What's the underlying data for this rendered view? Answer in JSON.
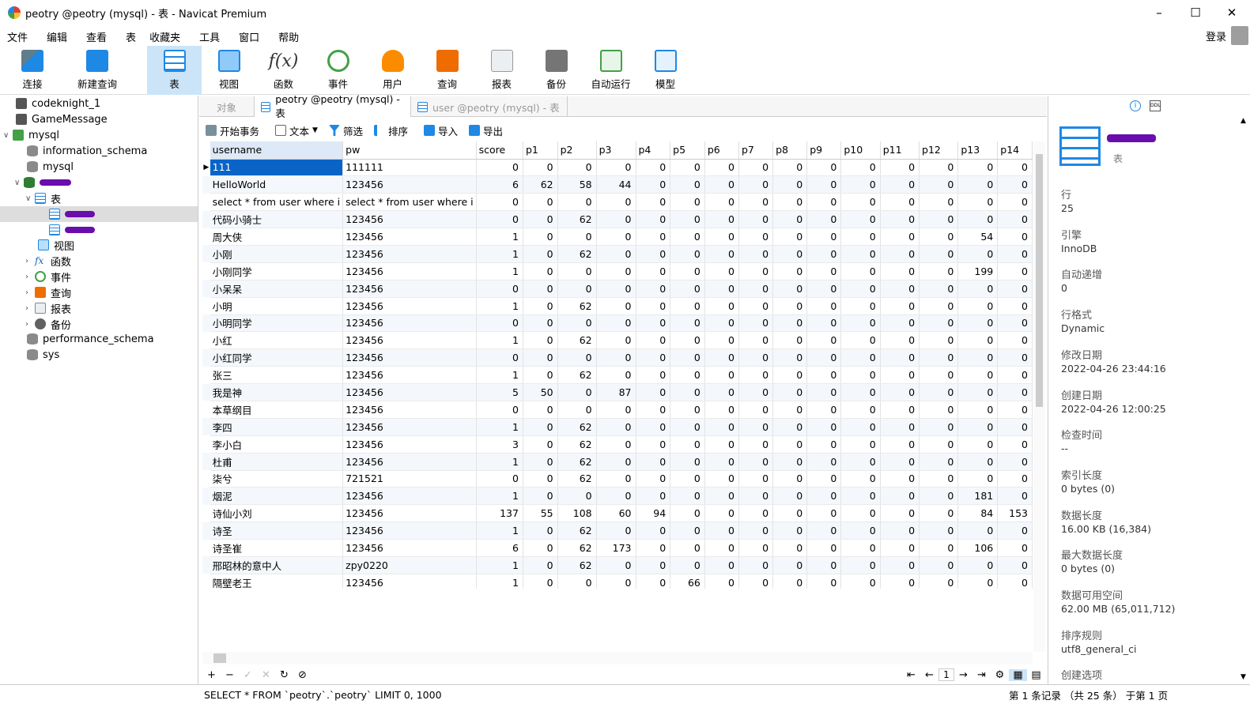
{
  "window": {
    "title": "peotry @peotry (mysql) - 表 - Navicat Premium"
  },
  "menu": [
    "文件",
    "编辑",
    "查看",
    "表",
    "收藏夹",
    "工具",
    "窗口",
    "帮助"
  ],
  "login_label": "登录",
  "toolbar": [
    {
      "label": "连接",
      "icon": "connection-icon"
    },
    {
      "label": "新建查询",
      "icon": "new-query-icon"
    },
    {
      "label": "表",
      "icon": "table-icon",
      "active": true
    },
    {
      "label": "视图",
      "icon": "view-icon"
    },
    {
      "label": "函数",
      "icon": "function-icon"
    },
    {
      "label": "事件",
      "icon": "event-clock-icon"
    },
    {
      "label": "用户",
      "icon": "user-icon"
    },
    {
      "label": "查询",
      "icon": "query-icon"
    },
    {
      "label": "报表",
      "icon": "report-icon"
    },
    {
      "label": "备份",
      "icon": "backup-icon"
    },
    {
      "label": "自动运行",
      "icon": "auto-run-icon"
    },
    {
      "label": "模型",
      "icon": "model-icon"
    }
  ],
  "tree": {
    "codeknight": "codeknight_1",
    "gamemessage": "GameMessage",
    "mysql_conn": "mysql",
    "information_schema": "information_schema",
    "mysql_db": "mysql",
    "tables_group": "表",
    "views": "视图",
    "functions": "函数",
    "events": "事件",
    "queries": "查询",
    "reports": "报表",
    "backups": "备份",
    "performance_schema": "performance_schema",
    "sys": "sys"
  },
  "tabs": {
    "objects": "对象",
    "active": "peotry @peotry (mysql) - 表",
    "other": "user @peotry (mysql) - 表"
  },
  "subtoolbar": {
    "begin": "开始事务",
    "text": "文本",
    "filter": "筛选",
    "sort": "排序",
    "import": "导入",
    "export": "导出"
  },
  "grid": {
    "columns": [
      "username",
      "pw",
      "score",
      "p1",
      "p2",
      "p3",
      "p4",
      "p5",
      "p6",
      "p7",
      "p8",
      "p9",
      "p10",
      "p11",
      "p12",
      "p13",
      "p14"
    ],
    "rows": [
      [
        "111",
        "111111",
        "0",
        "0",
        "0",
        "0",
        "0",
        "0",
        "0",
        "0",
        "0",
        "0",
        "0",
        "0",
        "0",
        "0",
        "0"
      ],
      [
        "HelloWorld",
        "123456",
        "6",
        "62",
        "58",
        "44",
        "0",
        "0",
        "0",
        "0",
        "0",
        "0",
        "0",
        "0",
        "0",
        "0",
        "0"
      ],
      [
        "select * from user where i",
        "select * from user where i",
        "0",
        "0",
        "0",
        "0",
        "0",
        "0",
        "0",
        "0",
        "0",
        "0",
        "0",
        "0",
        "0",
        "0",
        "0"
      ],
      [
        "代码小骑士",
        "123456",
        "0",
        "0",
        "62",
        "0",
        "0",
        "0",
        "0",
        "0",
        "0",
        "0",
        "0",
        "0",
        "0",
        "0",
        "0"
      ],
      [
        "周大侠",
        "123456",
        "1",
        "0",
        "0",
        "0",
        "0",
        "0",
        "0",
        "0",
        "0",
        "0",
        "0",
        "0",
        "0",
        "54",
        "0"
      ],
      [
        "小刚",
        "123456",
        "1",
        "0",
        "62",
        "0",
        "0",
        "0",
        "0",
        "0",
        "0",
        "0",
        "0",
        "0",
        "0",
        "0",
        "0"
      ],
      [
        "小刚同学",
        "123456",
        "1",
        "0",
        "0",
        "0",
        "0",
        "0",
        "0",
        "0",
        "0",
        "0",
        "0",
        "0",
        "0",
        "199",
        "0"
      ],
      [
        "小呆呆",
        "123456",
        "0",
        "0",
        "0",
        "0",
        "0",
        "0",
        "0",
        "0",
        "0",
        "0",
        "0",
        "0",
        "0",
        "0",
        "0"
      ],
      [
        "小明",
        "123456",
        "1",
        "0",
        "62",
        "0",
        "0",
        "0",
        "0",
        "0",
        "0",
        "0",
        "0",
        "0",
        "0",
        "0",
        "0"
      ],
      [
        "小明同学",
        "123456",
        "0",
        "0",
        "0",
        "0",
        "0",
        "0",
        "0",
        "0",
        "0",
        "0",
        "0",
        "0",
        "0",
        "0",
        "0"
      ],
      [
        "小红",
        "123456",
        "1",
        "0",
        "62",
        "0",
        "0",
        "0",
        "0",
        "0",
        "0",
        "0",
        "0",
        "0",
        "0",
        "0",
        "0"
      ],
      [
        "小红同学",
        "123456",
        "0",
        "0",
        "0",
        "0",
        "0",
        "0",
        "0",
        "0",
        "0",
        "0",
        "0",
        "0",
        "0",
        "0",
        "0"
      ],
      [
        "张三",
        "123456",
        "1",
        "0",
        "62",
        "0",
        "0",
        "0",
        "0",
        "0",
        "0",
        "0",
        "0",
        "0",
        "0",
        "0",
        "0"
      ],
      [
        "我是神",
        "123456",
        "5",
        "50",
        "0",
        "87",
        "0",
        "0",
        "0",
        "0",
        "0",
        "0",
        "0",
        "0",
        "0",
        "0",
        "0"
      ],
      [
        "本草纲目",
        "123456",
        "0",
        "0",
        "0",
        "0",
        "0",
        "0",
        "0",
        "0",
        "0",
        "0",
        "0",
        "0",
        "0",
        "0",
        "0"
      ],
      [
        "李四",
        "123456",
        "1",
        "0",
        "62",
        "0",
        "0",
        "0",
        "0",
        "0",
        "0",
        "0",
        "0",
        "0",
        "0",
        "0",
        "0"
      ],
      [
        "李小白",
        "123456",
        "3",
        "0",
        "62",
        "0",
        "0",
        "0",
        "0",
        "0",
        "0",
        "0",
        "0",
        "0",
        "0",
        "0",
        "0"
      ],
      [
        "杜甫",
        "123456",
        "1",
        "0",
        "62",
        "0",
        "0",
        "0",
        "0",
        "0",
        "0",
        "0",
        "0",
        "0",
        "0",
        "0",
        "0"
      ],
      [
        "柒兮",
        "721521",
        "0",
        "0",
        "62",
        "0",
        "0",
        "0",
        "0",
        "0",
        "0",
        "0",
        "0",
        "0",
        "0",
        "0",
        "0"
      ],
      [
        "烟泥",
        "123456",
        "1",
        "0",
        "0",
        "0",
        "0",
        "0",
        "0",
        "0",
        "0",
        "0",
        "0",
        "0",
        "0",
        "181",
        "0"
      ],
      [
        "诗仙小刘",
        "123456",
        "137",
        "55",
        "108",
        "60",
        "94",
        "0",
        "0",
        "0",
        "0",
        "0",
        "0",
        "0",
        "0",
        "84",
        "153"
      ],
      [
        "诗圣",
        "123456",
        "1",
        "0",
        "62",
        "0",
        "0",
        "0",
        "0",
        "0",
        "0",
        "0",
        "0",
        "0",
        "0",
        "0",
        "0"
      ],
      [
        "诗圣崔",
        "123456",
        "6",
        "0",
        "62",
        "173",
        "0",
        "0",
        "0",
        "0",
        "0",
        "0",
        "0",
        "0",
        "0",
        "106",
        "0"
      ],
      [
        "邢昭林的意中人",
        "zpy0220",
        "1",
        "0",
        "62",
        "0",
        "0",
        "0",
        "0",
        "0",
        "0",
        "0",
        "0",
        "0",
        "0",
        "0",
        "0"
      ],
      [
        "隔壁老王",
        "123456",
        "1",
        "0",
        "0",
        "0",
        "0",
        "66",
        "0",
        "0",
        "0",
        "0",
        "0",
        "0",
        "0",
        "0",
        "0"
      ]
    ]
  },
  "nav": {
    "page": "1"
  },
  "status": {
    "sql": "SELECT * FROM `peotry`.`peotry` LIMIT 0, 1000",
    "records": "第 1 条记录 （共 25 条） 于第 1 页"
  },
  "info": {
    "subtitle": "表",
    "fields": [
      {
        "k": "行",
        "v": "25"
      },
      {
        "k": "引擎",
        "v": "InnoDB"
      },
      {
        "k": "自动递增",
        "v": "0"
      },
      {
        "k": "行格式",
        "v": "Dynamic"
      },
      {
        "k": "修改日期",
        "v": "2022-04-26 23:44:16"
      },
      {
        "k": "创建日期",
        "v": "2022-04-26 12:00:25"
      },
      {
        "k": "检查时间",
        "v": "--"
      },
      {
        "k": "索引长度",
        "v": "0 bytes (0)"
      },
      {
        "k": "数据长度",
        "v": "16.00 KB (16,384)"
      },
      {
        "k": "最大数据长度",
        "v": "0 bytes (0)"
      },
      {
        "k": "数据可用空间",
        "v": "62.00 MB (65,011,712)"
      },
      {
        "k": "排序规则",
        "v": "utf8_general_ci"
      },
      {
        "k": "创建选项",
        "v": ""
      }
    ]
  },
  "colors": {
    "selection": "#0a64c8",
    "accent": "#1e88e5",
    "active_tool": "#cce4f7"
  }
}
